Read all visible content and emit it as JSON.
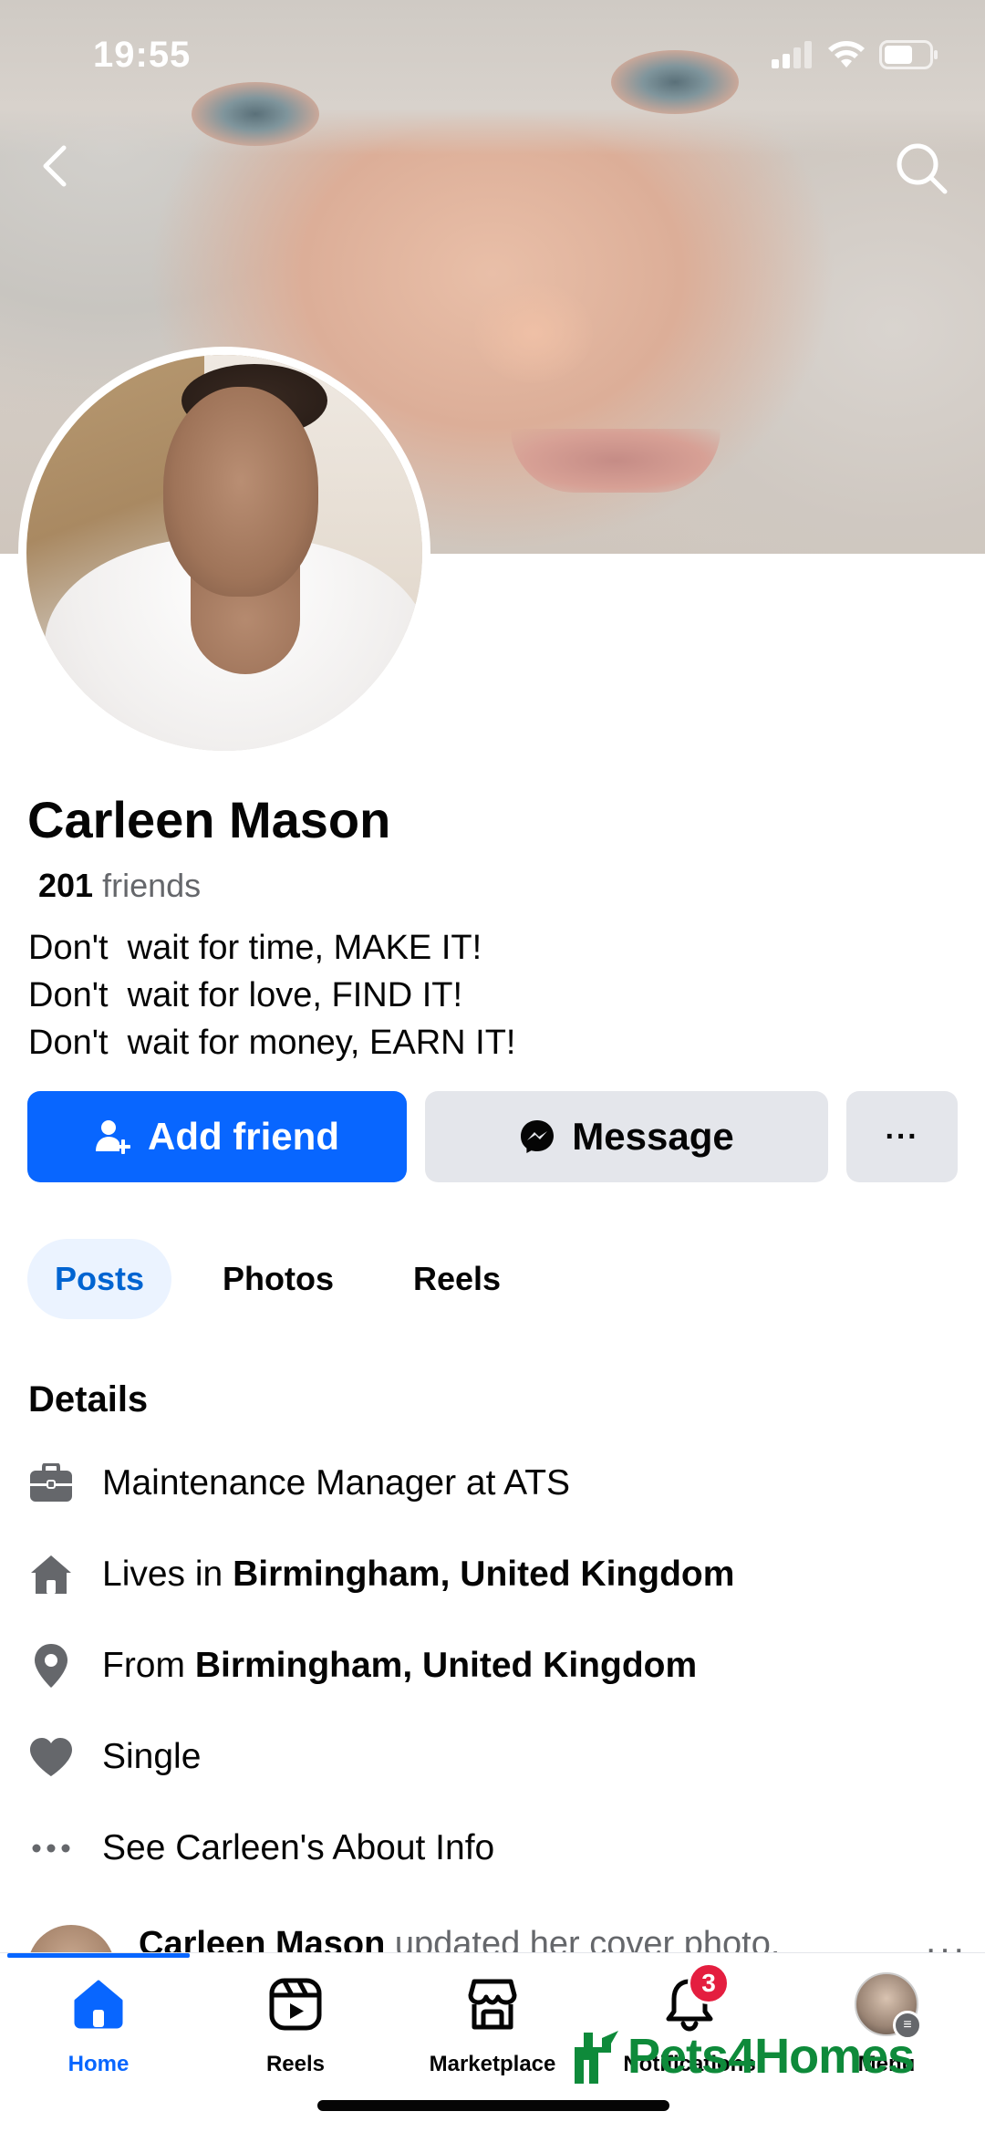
{
  "status_bar": {
    "time": "19:55"
  },
  "profile": {
    "name": "Carleen Mason",
    "friends_count": "201",
    "friends_label": "friends",
    "bio": [
      "Don't  wait for time, MAKE IT!",
      "Don't  wait for love, FIND IT!",
      "Don't  wait for money, EARN IT!"
    ]
  },
  "actions": {
    "add_friend": "Add friend",
    "message": "Message",
    "more": "···"
  },
  "tabs": [
    {
      "label": "Posts",
      "active": true
    },
    {
      "label": "Photos",
      "active": false
    },
    {
      "label": "Reels",
      "active": false
    }
  ],
  "details": {
    "title": "Details",
    "work": "Maintenance Manager at ATS",
    "lives_prefix": "Lives in ",
    "lives_place": "Birmingham, United Kingdom",
    "from_prefix": "From ",
    "from_place": "Birmingham, United Kingdom",
    "relationship": "Single",
    "about_link": "See Carleen's About Info"
  },
  "post_preview": {
    "author": "Carleen Mason",
    "text": " updated her cover photo.",
    "more": "···"
  },
  "nav": {
    "items": [
      {
        "label": "Home",
        "icon": "home-icon",
        "active": true
      },
      {
        "label": "Reels",
        "icon": "reels-icon",
        "active": false
      },
      {
        "label": "Marketplace",
        "icon": "marketplace-icon",
        "active": false
      },
      {
        "label": "Notifications",
        "icon": "bell-icon",
        "active": false,
        "badge": "3"
      },
      {
        "label": "Menu",
        "icon": "menu-avatar",
        "active": false
      }
    ]
  },
  "watermark": "Pets4Homes",
  "colors": {
    "brand_blue": "#0866ff",
    "secondary_button": "#e4e6eb",
    "muted_text": "#65676b",
    "badge_red": "#e41e3f",
    "tab_active_bg": "#ebf3ff",
    "watermark_green": "#0e8a3a"
  }
}
